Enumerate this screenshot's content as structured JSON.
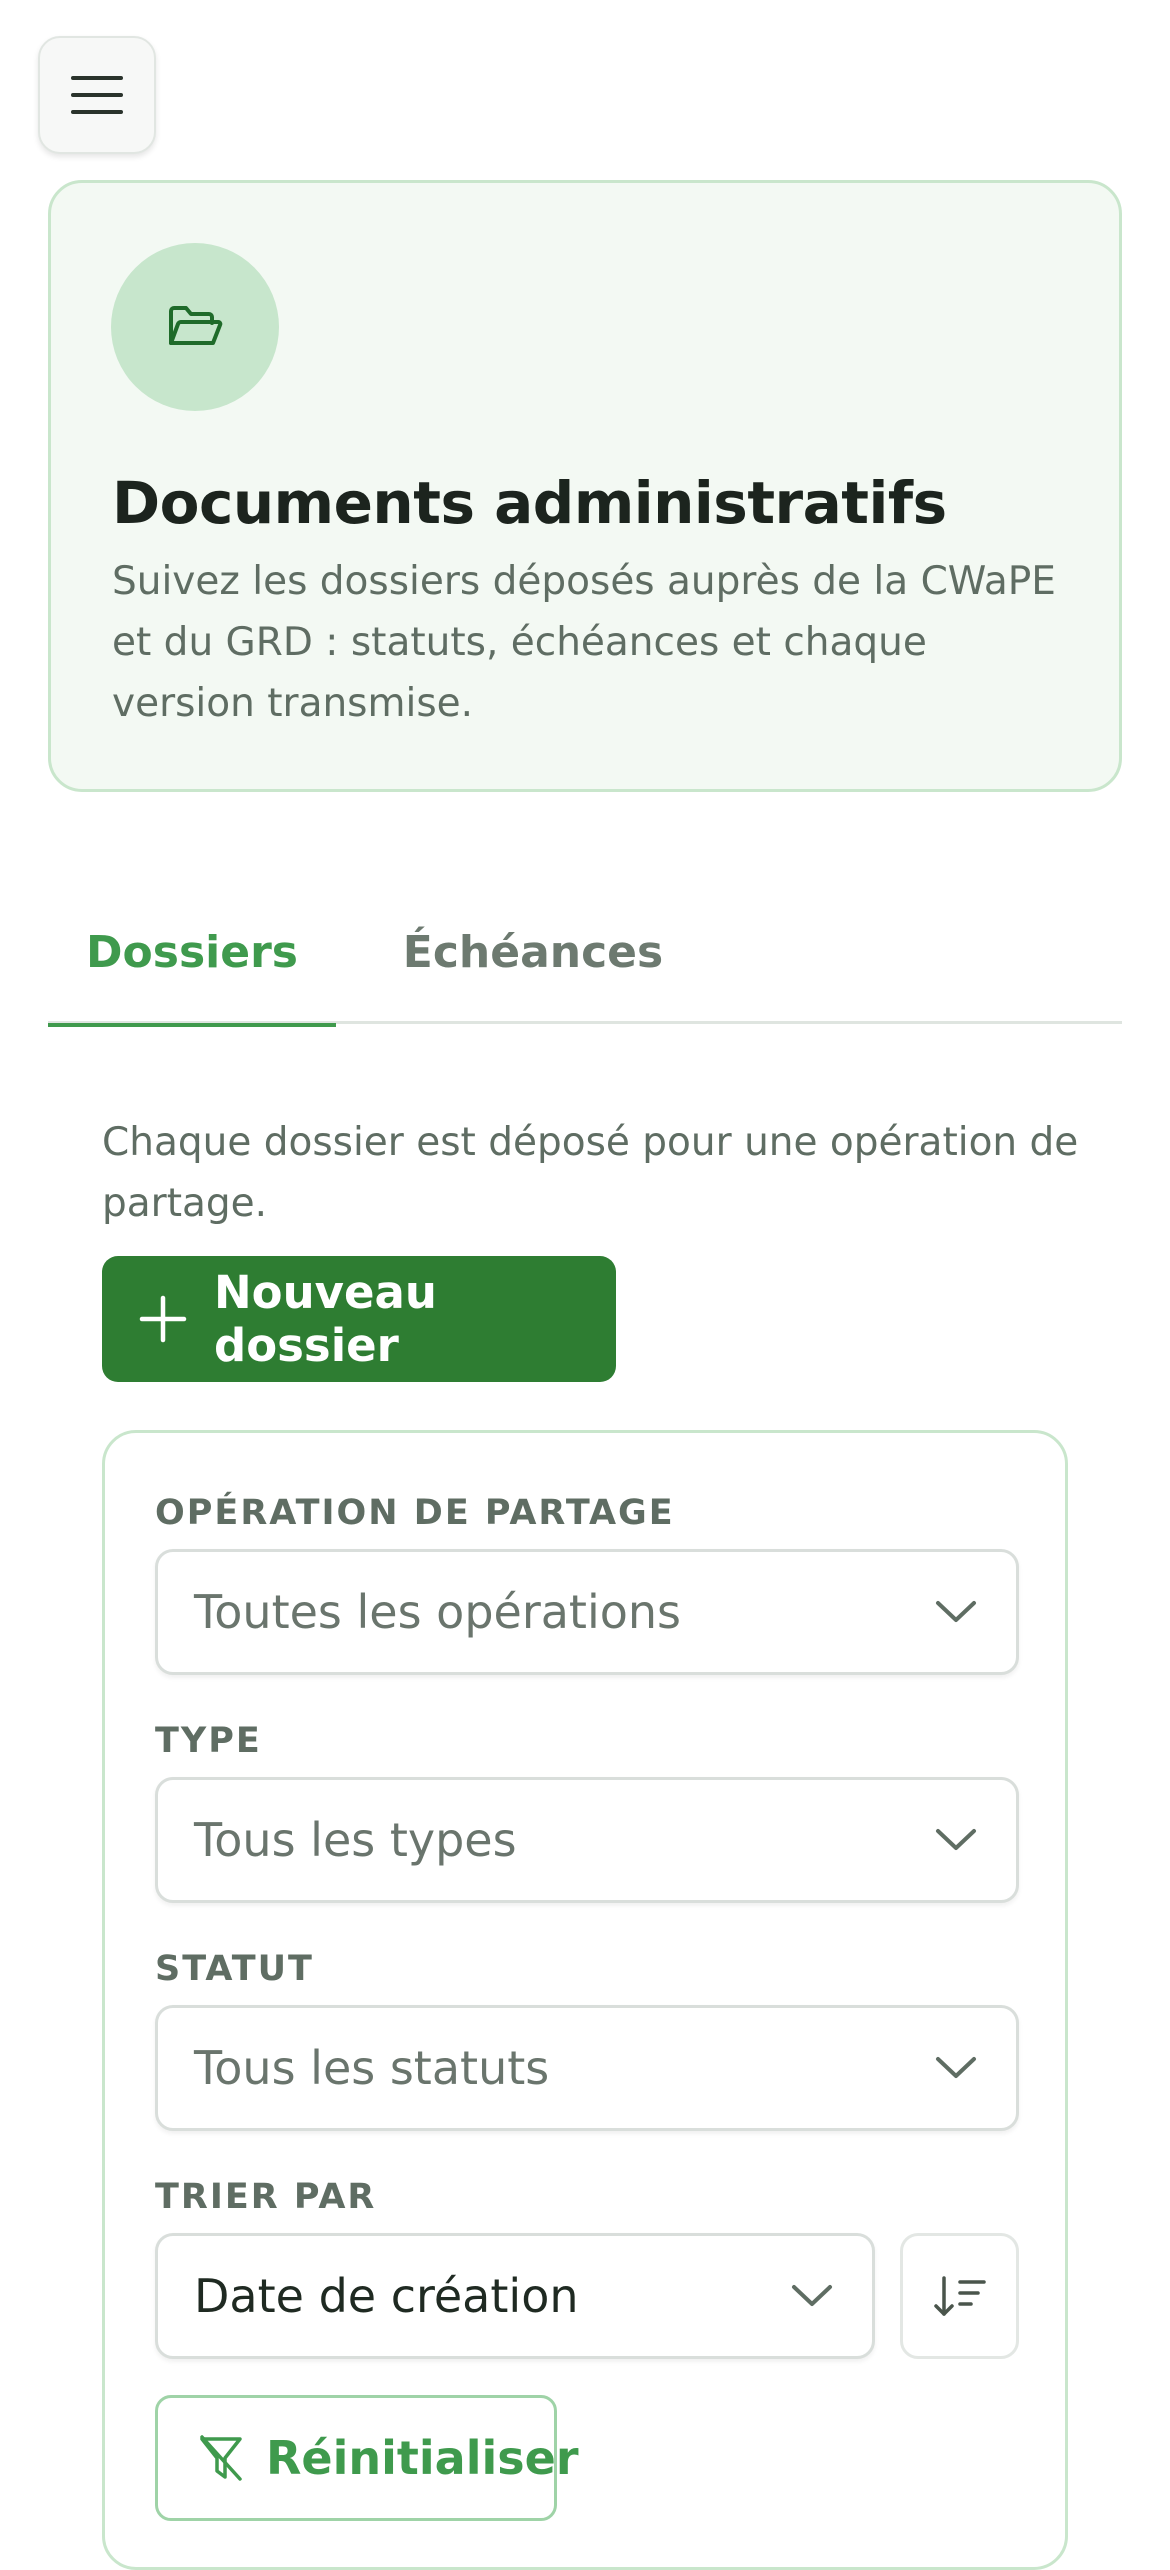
{
  "menu": {
    "icon": "hamburger-menu-icon"
  },
  "hero": {
    "icon": "folder-open-icon",
    "title": "Documents administratifs",
    "description": "Suivez les dossiers déposés auprès de la CWaPE et du GRD : statuts, échéances et chaque version transmise."
  },
  "tabs": [
    {
      "label": "Dossiers",
      "active": true
    },
    {
      "label": "Échéances",
      "active": false
    }
  ],
  "intro": "Chaque dossier est déposé pour une opération de partage.",
  "new_button": {
    "label": "Nouveau dossier",
    "icon": "plus-icon"
  },
  "filters": {
    "operation": {
      "label": "OPÉRATION DE PARTAGE",
      "value": "Toutes les opérations"
    },
    "type": {
      "label": "TYPE",
      "value": "Tous les types"
    },
    "status": {
      "label": "STATUT",
      "value": "Tous les statuts"
    },
    "sort": {
      "label": "TRIER PAR",
      "value": "Date de création",
      "direction_icon": "sort-descending-icon"
    },
    "reset": {
      "label": "Réinitialiser",
      "icon": "filter-reset-icon"
    }
  },
  "colors": {
    "accent": "#2e7d32",
    "accent_text": "#3f9a4d",
    "hero_bg": "#f3f9f3",
    "hero_border": "#c9e6cc"
  }
}
